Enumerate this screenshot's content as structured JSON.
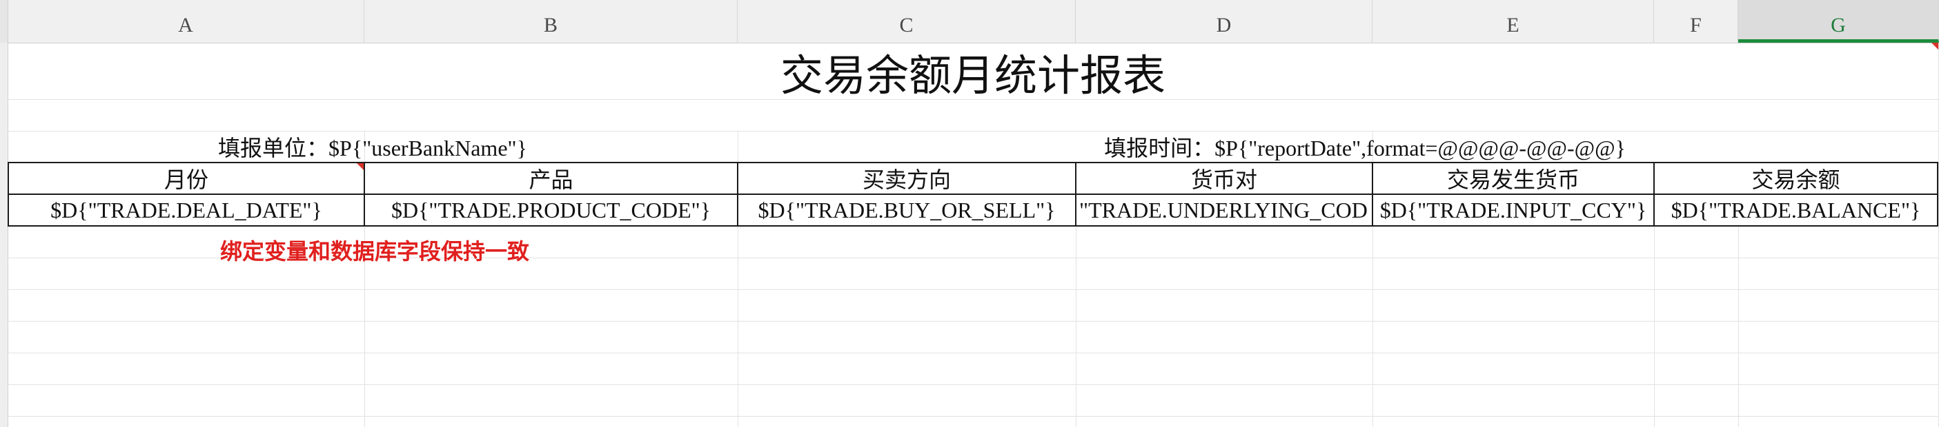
{
  "columns": [
    "A",
    "B",
    "C",
    "D",
    "E",
    "F",
    "G"
  ],
  "selected_column": "G",
  "report": {
    "title": "交易余额月统计报表",
    "fill_unit": "填报单位：$P{\"userBankName\"}",
    "fill_time": "填报时间：$P{\"reportDate\",format=@@@@-@@-@@}"
  },
  "table": {
    "headers": [
      "月份",
      "产品",
      "买卖方向",
      "货币对",
      "交易发生货币",
      "交易余额"
    ],
    "row": [
      "$D{\"TRADE.DEAL_DATE\"}",
      "$D{\"TRADE.PRODUCT_CODE\"}",
      "$D{\"TRADE.BUY_OR_SELL\"}",
      "\"TRADE.UNDERLYING_COD",
      "$D{\"TRADE.INPUT_CCY\"}",
      "$D{\"TRADE.BALANCE\"}"
    ]
  },
  "note": "绑定变量和数据库字段保持一致"
}
